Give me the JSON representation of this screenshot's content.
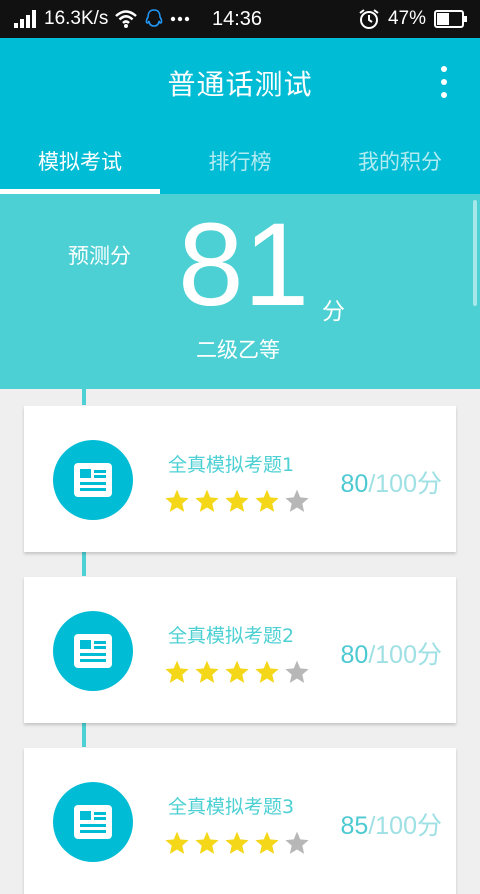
{
  "status_bar": {
    "speed": "16.3K/s",
    "time": "14:36",
    "battery": "47%"
  },
  "header": {
    "title": "普通话测试"
  },
  "tabs": [
    {
      "label": "模拟考试",
      "active": true
    },
    {
      "label": "排行榜",
      "active": false
    },
    {
      "label": "我的积分",
      "active": false
    }
  ],
  "prediction": {
    "label": "预测分",
    "score": "81",
    "unit": "分",
    "level": "二级乙等"
  },
  "tests": [
    {
      "title": "全真模拟考题1",
      "score": "80",
      "total": "/100分",
      "stars": 4
    },
    {
      "title": "全真模拟考题2",
      "score": "80",
      "total": "/100分",
      "stars": 4
    },
    {
      "title": "全真模拟考题3",
      "score": "85",
      "total": "/100分",
      "stars": 4
    }
  ],
  "colors": {
    "primary": "#00bcd4",
    "banner": "#4dd0d3",
    "star_filled": "#f5d71a",
    "star_empty": "#b7b7b7"
  },
  "icons": [
    "signal-icon",
    "wifi-icon",
    "qq-icon",
    "more-icon",
    "alarm-icon",
    "battery-icon",
    "overflow-menu-icon",
    "document-icon",
    "star-icon"
  ]
}
